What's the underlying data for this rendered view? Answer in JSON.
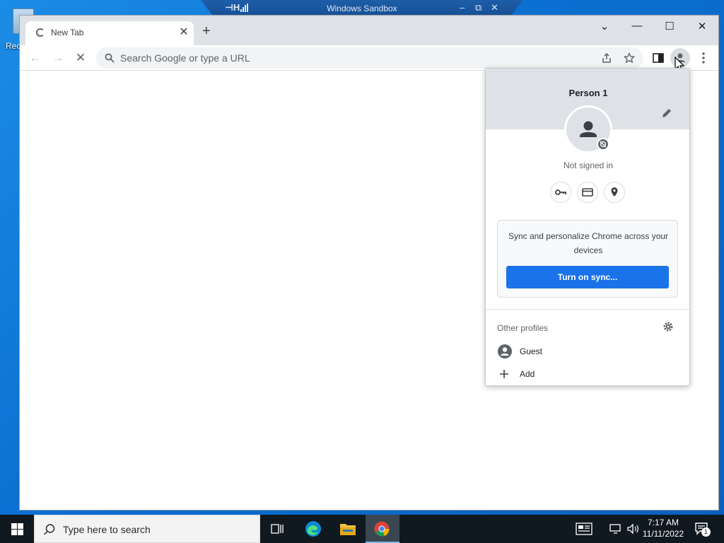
{
  "desktop": {
    "recycle_bin_label": "Rec"
  },
  "sandbox": {
    "title": "Windows Sandbox",
    "pin_glyph": "⊣H",
    "minimize_glyph": "–",
    "restore_glyph": "⧉",
    "close_glyph": "✕"
  },
  "browser": {
    "tab": {
      "title": "New Tab",
      "close_glyph": "✕"
    },
    "new_tab_glyph": "+",
    "window_controls": {
      "dropdown": "⌄",
      "minimize": "—",
      "maximize": "☐",
      "close": "✕"
    },
    "toolbar": {
      "back_glyph": "←",
      "forward_glyph": "→",
      "stop_glyph": "✕"
    },
    "omnibox": {
      "placeholder": "Search Google or type a URL"
    }
  },
  "profile_menu": {
    "name": "Person 1",
    "status": "Not signed in",
    "sync_prompt": "Sync and personalize Chrome across your devices",
    "sync_button": "Turn on sync...",
    "other_profiles_label": "Other profiles",
    "profiles": [
      {
        "label": "Guest",
        "icon": "guest-avatar-icon"
      },
      {
        "label": "Add",
        "icon": "plus-icon"
      }
    ],
    "quick_buttons": [
      "key-icon",
      "credit-card-icon",
      "location-pin-icon"
    ]
  },
  "taskbar": {
    "search_placeholder": "Type here to search",
    "apps": [
      "task-view-icon",
      "edge-icon",
      "file-explorer-icon",
      "chrome-icon"
    ],
    "time": "7:17 AM",
    "date": "11/11/2022",
    "notification_count": "1"
  },
  "colors": {
    "accent": "#1a73e8",
    "desktop": "#0a74d4",
    "taskbar": "#101820"
  }
}
